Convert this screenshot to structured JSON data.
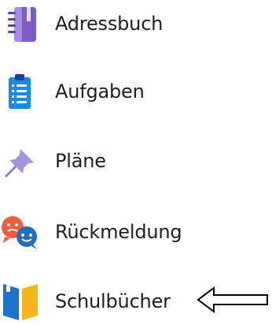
{
  "menu": {
    "items": [
      {
        "label": "Adressbuch",
        "icon": "address-book-icon"
      },
      {
        "label": "Aufgaben",
        "icon": "clipboard-list-icon"
      },
      {
        "label": "Pläne",
        "icon": "pushpin-icon"
      },
      {
        "label": "Rückmeldung",
        "icon": "feedback-chat-icon"
      },
      {
        "label": "Schulbücher",
        "icon": "books-icon"
      }
    ]
  },
  "colors": {
    "addressbook": "#7c5cc4",
    "clipboard": "#1e88e5",
    "pin": "#a392de",
    "feedback_red": "#f05d3b",
    "feedback_blue": "#1e6fc4",
    "books_blue": "#1d72c9",
    "books_yellow": "#f5b51c"
  }
}
